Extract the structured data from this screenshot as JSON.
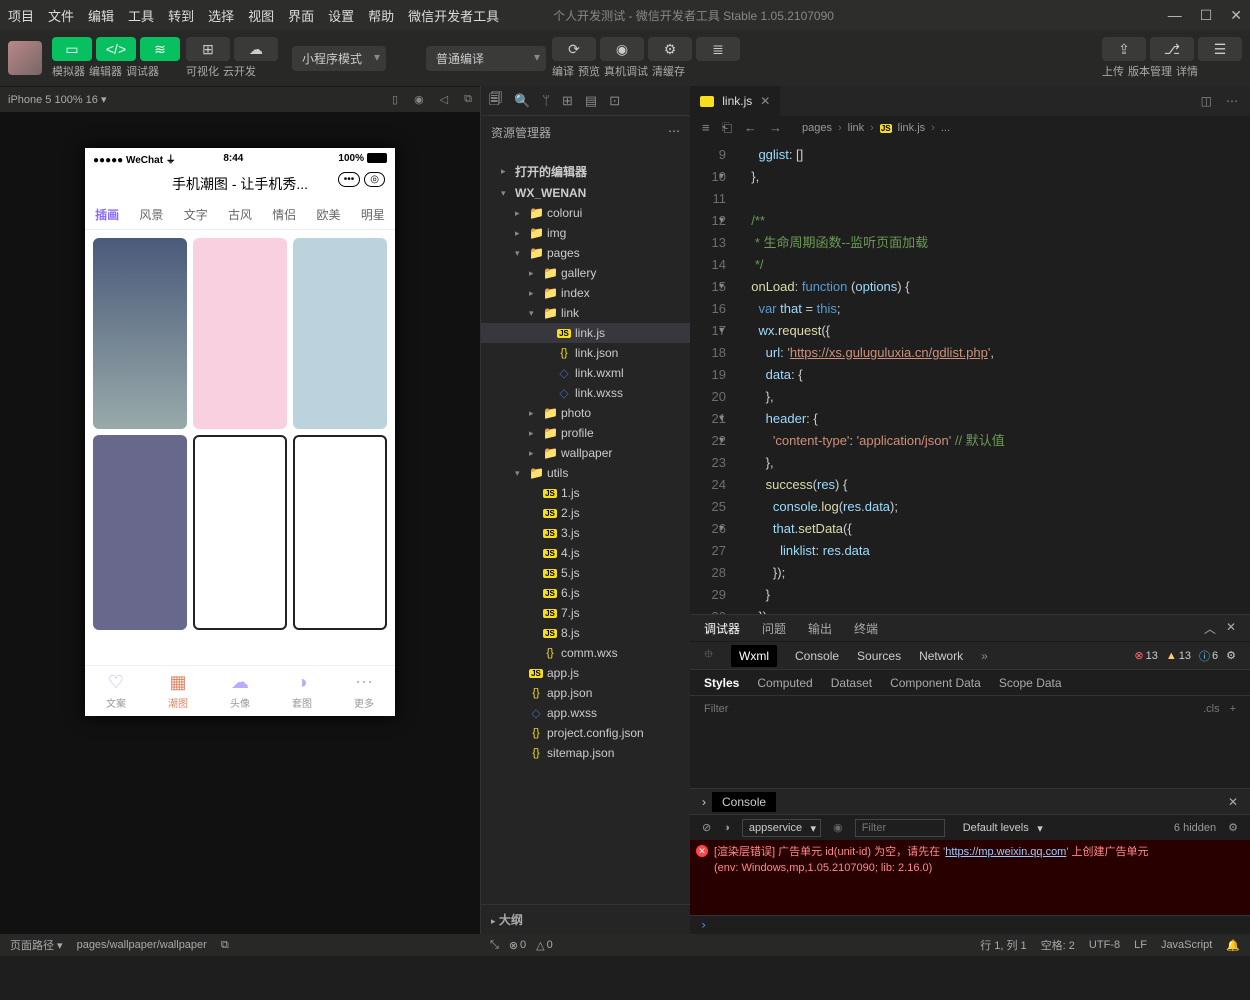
{
  "menu": {
    "items": [
      "项目",
      "文件",
      "编辑",
      "工具",
      "转到",
      "选择",
      "视图",
      "界面",
      "设置",
      "帮助",
      "微信开发者工具"
    ],
    "title": "个人开发测试 - 微信开发者工具 Stable 1.05.2107090"
  },
  "toolbar": {
    "simulator": "模拟器",
    "editor": "编辑器",
    "debugger": "调试器",
    "visual": "可视化",
    "cloud": "云开发",
    "mode_select": "小程序模式",
    "compile_select": "普通编译",
    "compile": "编译",
    "preview": "预览",
    "remote": "真机调试",
    "clearcache": "清缓存",
    "upload": "上传",
    "version": "版本管理",
    "details": "详情"
  },
  "sim": {
    "device": "iPhone 5 100% 16",
    "wechat": "WeChat",
    "time": "8:44",
    "battery": "100%",
    "app_title": "手机潮图 - 让手机秀...",
    "tabs": [
      "插画",
      "风景",
      "文字",
      "古风",
      "情侣",
      "欧美",
      "明星"
    ],
    "nav": [
      {
        "l": "文案"
      },
      {
        "l": "潮图"
      },
      {
        "l": "头像"
      },
      {
        "l": "套图"
      },
      {
        "l": "更多"
      }
    ]
  },
  "explorer": {
    "title": "资源管理器",
    "openeditors": "打开的编辑器",
    "project": "WX_WENAN",
    "tree": [
      {
        "t": "colorui",
        "k": "fold",
        "d": 2
      },
      {
        "t": "img",
        "k": "foldg",
        "d": 2
      },
      {
        "t": "pages",
        "k": "foldg",
        "d": 2,
        "open": true
      },
      {
        "t": "gallery",
        "k": "fold",
        "d": 3
      },
      {
        "t": "index",
        "k": "fold",
        "d": 3
      },
      {
        "t": "link",
        "k": "fold",
        "d": 3,
        "open": true
      },
      {
        "t": "link.js",
        "k": "js",
        "d": 4,
        "sel": true
      },
      {
        "t": "link.json",
        "k": "json",
        "d": 4
      },
      {
        "t": "link.wxml",
        "k": "wxml",
        "d": 4
      },
      {
        "t": "link.wxss",
        "k": "wxss",
        "d": 4
      },
      {
        "t": "photo",
        "k": "fold",
        "d": 3
      },
      {
        "t": "profile",
        "k": "fold",
        "d": 3
      },
      {
        "t": "wallpaper",
        "k": "fold",
        "d": 3
      },
      {
        "t": "utils",
        "k": "foldg",
        "d": 2,
        "open": true
      },
      {
        "t": "1.js",
        "k": "js",
        "d": 3
      },
      {
        "t": "2.js",
        "k": "js",
        "d": 3
      },
      {
        "t": "3.js",
        "k": "js",
        "d": 3
      },
      {
        "t": "4.js",
        "k": "js",
        "d": 3
      },
      {
        "t": "5.js",
        "k": "js",
        "d": 3
      },
      {
        "t": "6.js",
        "k": "js",
        "d": 3
      },
      {
        "t": "7.js",
        "k": "js",
        "d": 3
      },
      {
        "t": "8.js",
        "k": "js",
        "d": 3
      },
      {
        "t": "comm.wxs",
        "k": "json",
        "d": 3
      },
      {
        "t": "app.js",
        "k": "js",
        "d": 2
      },
      {
        "t": "app.json",
        "k": "json",
        "d": 2
      },
      {
        "t": "app.wxss",
        "k": "wxss",
        "d": 2
      },
      {
        "t": "project.config.json",
        "k": "json",
        "d": 2
      },
      {
        "t": "sitemap.json",
        "k": "json",
        "d": 2
      }
    ],
    "outline": "大纲"
  },
  "editor": {
    "tab": "link.js",
    "crumbs": [
      "pages",
      "link",
      "link.js",
      "..."
    ],
    "lines_start": 9,
    "code_url": "https://xs.guluguluxia.cn/gdlist.php",
    "code_comment1": "生命周期函数--监听页面加载",
    "code_comment2": "// 默认值"
  },
  "debugger": {
    "tabs_top": [
      "调试器",
      "问题",
      "输出",
      "终端"
    ],
    "panels": [
      "Wxml",
      "Console",
      "Sources",
      "Network"
    ],
    "badges": {
      "err": "13",
      "warn": "13",
      "info": "6"
    },
    "style_tabs": [
      "Styles",
      "Computed",
      "Dataset",
      "Component Data",
      "Scope Data"
    ],
    "filter_ph": "Filter",
    "cls": ".cls",
    "console": "Console",
    "context": "appservice",
    "levels": "Default levels",
    "hidden": "6 hidden",
    "err_prefix": "[渲染层错误] 广告单元 id(unit-id) 为空，请先在 '",
    "err_url": "https://mp.weixin.qq.com",
    "err_suffix": "' 上创建广告单元",
    "err_env": "(env: Windows,mp,1.05.2107090; lib: 2.16.0)"
  },
  "status": {
    "route_lbl": "页面路径",
    "route": "pages/wallpaper/wallpaper",
    "err0": "0",
    "warn0": "0",
    "pos": "行 1, 列 1",
    "spaces": "空格: 2",
    "enc": "UTF-8",
    "eol": "LF",
    "lang": "JavaScript"
  }
}
